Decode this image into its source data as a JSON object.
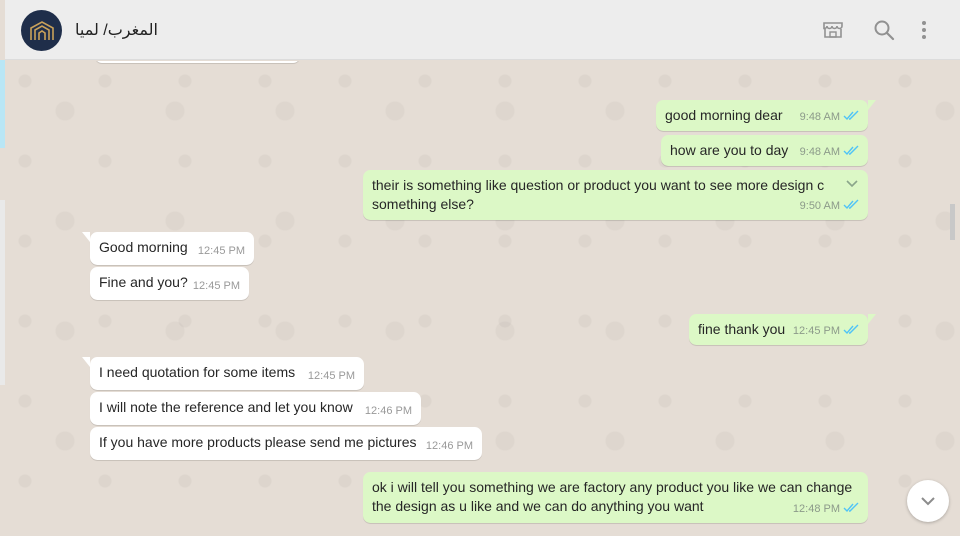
{
  "header": {
    "contact_name": "المغرب/ لميا",
    "icons": [
      "store-icon",
      "search-icon",
      "menu-icon"
    ]
  },
  "messages": [
    {
      "dir": "out",
      "text": "good morning dear",
      "time": "9:48 AM",
      "status": "read"
    },
    {
      "dir": "out",
      "text": "how are you to day",
      "time": "9:48 AM",
      "status": "read"
    },
    {
      "dir": "out",
      "text": "their is something like question or product you want to see more design c",
      "text2": "something else?",
      "time": "9:50 AM",
      "status": "read"
    },
    {
      "dir": "in",
      "text": "Good morning",
      "time": "12:45 PM"
    },
    {
      "dir": "in",
      "text": "Fine and you?",
      "time": "12:45 PM"
    },
    {
      "dir": "out",
      "text": "fine thank you",
      "time": "12:45 PM",
      "status": "read"
    },
    {
      "dir": "in",
      "text": "I need quotation for some items",
      "time": "12:45 PM"
    },
    {
      "dir": "in",
      "text": "I will note the reference and let you know",
      "time": "12:46 PM"
    },
    {
      "dir": "in",
      "text": "If you have more products please send me pictures",
      "time": "12:46 PM"
    },
    {
      "dir": "out",
      "text": "ok i will tell you something we are factory any product you like we can change",
      "text2": "the design as u like and we can do anything you want",
      "time": "12:48 PM",
      "status": "read"
    }
  ],
  "colors": {
    "outgoing_bubble": "#dcf8c6",
    "incoming_bubble": "#ffffff",
    "read_tick": "#4fc3f7",
    "header_bg": "#ededed",
    "chat_bg": "#e5ddd5"
  }
}
